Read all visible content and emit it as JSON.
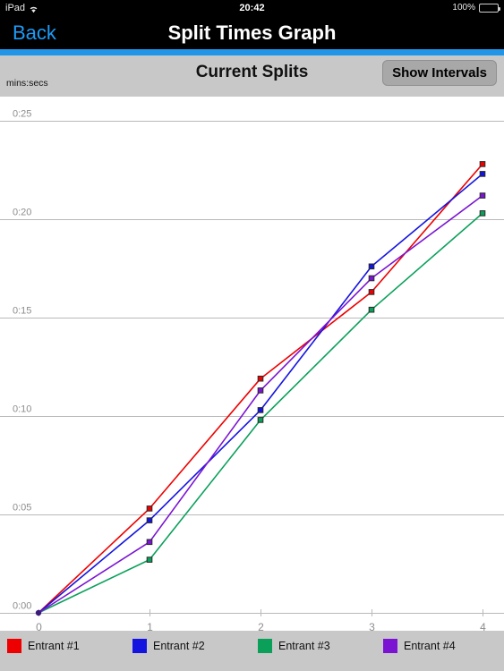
{
  "status_bar": {
    "device": "iPad",
    "wifi_icon": "wifi-icon",
    "time": "20:42",
    "battery_percent": "100%",
    "battery_icon": "battery-full-icon"
  },
  "nav_bar": {
    "back_label": "Back",
    "title": "Split Times Graph",
    "accent_color": "#1d9bf7",
    "rule_color": "#2196e8"
  },
  "toolbar": {
    "units_label": "mins:secs",
    "panel_title": "Current Splits",
    "show_intervals_label": "Show Intervals"
  },
  "chart_data": {
    "type": "line",
    "title": "Current Splits",
    "xlabel": "",
    "ylabel": "mins:secs",
    "x": [
      0,
      1,
      2,
      3,
      4
    ],
    "x_tick_labels": [
      "0",
      "1",
      "2",
      "3",
      "4"
    ],
    "y_tick_values": [
      0,
      5,
      10,
      15,
      20,
      25
    ],
    "y_tick_labels": [
      "0:00",
      "0:05",
      "0:10",
      "0:15",
      "0:20",
      "0:25"
    ],
    "ylim": [
      0,
      27
    ],
    "xlim": [
      -0.35,
      4.2
    ],
    "grid": true,
    "legend_position": "bottom",
    "markers": "square",
    "series": [
      {
        "name": "Entrant #1",
        "color": "#ee0000",
        "values": [
          0,
          5.3,
          11.9,
          16.3,
          22.8
        ]
      },
      {
        "name": "Entrant #2",
        "color": "#1414e0",
        "values": [
          0,
          4.7,
          10.3,
          17.6,
          22.3
        ]
      },
      {
        "name": "Entrant #3",
        "color": "#0aa05a",
        "values": [
          0,
          2.7,
          9.8,
          15.4,
          20.3
        ]
      },
      {
        "name": "Entrant #4",
        "color": "#7a14d2",
        "values": [
          0,
          3.6,
          11.3,
          17.0,
          21.2
        ]
      }
    ]
  },
  "legend": {
    "items": [
      {
        "label": "Entrant #1",
        "color": "#ee0000"
      },
      {
        "label": "Entrant #2",
        "color": "#1414e0"
      },
      {
        "label": "Entrant #3",
        "color": "#0aa05a"
      },
      {
        "label": "Entrant #4",
        "color": "#7a14d2"
      }
    ]
  }
}
